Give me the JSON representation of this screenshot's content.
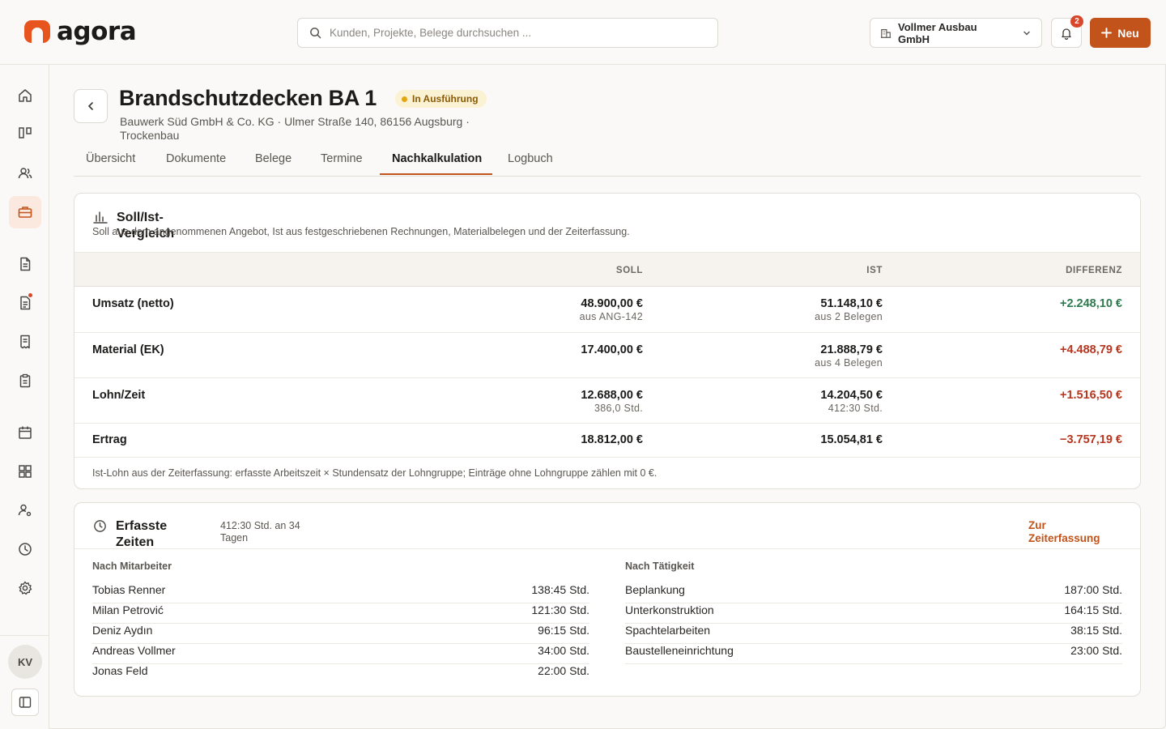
{
  "app": {
    "logo_text": "agora",
    "brand_color": "#c2531a"
  },
  "search": {
    "placeholder": "Kunden, Projekte, Belege durchsuchen ..."
  },
  "company": {
    "name": "Vollmer Ausbau GmbH"
  },
  "notifications": {
    "count": "2"
  },
  "new_button": {
    "label": "Neu"
  },
  "sidebar": {
    "items": [
      {
        "icon": "home-icon"
      },
      {
        "icon": "board-icon"
      },
      {
        "icon": "users-icon"
      },
      {
        "icon": "briefcase-icon",
        "active": true
      },
      {
        "icon": "document-icon"
      },
      {
        "icon": "invoice-icon",
        "badge": true
      },
      {
        "icon": "receipt-icon"
      },
      {
        "icon": "clipboard-icon"
      },
      {
        "icon": "calendar-icon"
      },
      {
        "icon": "grid-icon"
      },
      {
        "icon": "user-settings-icon"
      },
      {
        "icon": "clock-icon"
      },
      {
        "icon": "gear-icon"
      }
    ],
    "avatar": "KV"
  },
  "project": {
    "title": "Brandschutzdecken BA 1",
    "status": "In Ausführung",
    "subtitle": "Bauwerk Süd GmbH & Co. KG · Ulmer Straße 140, 86156 Augsburg · Trockenbau"
  },
  "tabs": [
    "Übersicht",
    "Dokumente",
    "Belege",
    "Termine",
    "Nachkalkulation",
    "Logbuch"
  ],
  "active_tab": "Nachkalkulation",
  "comparison": {
    "title": "Soll/Ist-Vergleich",
    "description": "Soll aus dem angenommenen Angebot, Ist aus festgeschriebenen Rechnungen, Materialbelegen und der Zeiterfassung.",
    "columns": [
      "SOLL",
      "IST",
      "DIFFERENZ"
    ],
    "rows": [
      {
        "label": "Umsatz (netto)",
        "soll": "48.900,00 €",
        "soll_sub": "aus ANG-142",
        "ist": "51.148,10 €",
        "ist_sub": "aus 2 Belegen",
        "diff": "+2.248,10 €",
        "diff_tone": "pos"
      },
      {
        "label": "Material (EK)",
        "soll": "17.400,00 €",
        "soll_sub": "",
        "ist": "21.888,79 €",
        "ist_sub": "aus 4 Belegen",
        "diff": "+4.488,79 €",
        "diff_tone": "neg"
      },
      {
        "label": "Lohn/Zeit",
        "soll": "12.688,00 €",
        "soll_sub": "386,0 Std.",
        "ist": "14.204,50 €",
        "ist_sub": "412:30 Std.",
        "diff": "+1.516,50 €",
        "diff_tone": "neg"
      },
      {
        "label": "Ertrag",
        "soll": "18.812,00 €",
        "soll_sub": "",
        "ist": "15.054,81 €",
        "ist_sub": "",
        "diff": "−3.757,19 €",
        "diff_tone": "neg"
      }
    ],
    "footnote": "Ist-Lohn aus der Zeiterfassung: erfasste Arbeitszeit × Stundensatz der Lohngruppe; Einträge ohne Lohngruppe zählen mit 0 €."
  },
  "times": {
    "title": "Erfasste Zeiten",
    "summary": "412:30 Std. an 34 Tagen",
    "link": "Zur Zeiterfassung",
    "by_employee_title": "Nach Mitarbeiter",
    "by_employee": [
      {
        "name": "Tobias Renner",
        "hours": "138:45 Std."
      },
      {
        "name": "Milan Petrović",
        "hours": "121:30 Std."
      },
      {
        "name": "Deniz Aydın",
        "hours": "96:15 Std."
      },
      {
        "name": "Andreas Vollmer",
        "hours": "34:00 Std."
      },
      {
        "name": "Jonas Feld",
        "hours": "22:00 Std."
      }
    ],
    "by_activity_title": "Nach Tätigkeit",
    "by_activity": [
      {
        "name": "Beplankung",
        "hours": "187:00 Std."
      },
      {
        "name": "Unterkonstruktion",
        "hours": "164:15 Std."
      },
      {
        "name": "Spachtelarbeiten",
        "hours": "38:15 Std."
      },
      {
        "name": "Baustelleneinrichtung",
        "hours": "23:00 Std."
      }
    ]
  }
}
